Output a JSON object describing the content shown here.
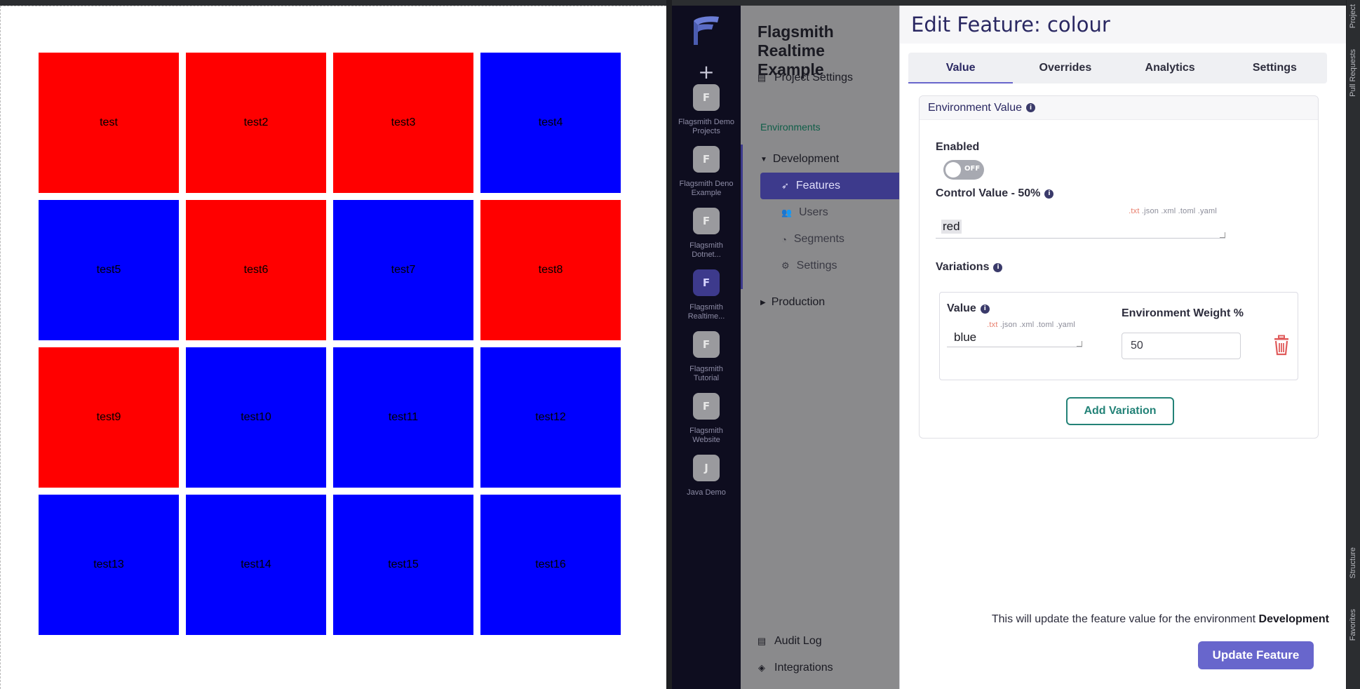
{
  "grid": {
    "cells": [
      {
        "label": "test",
        "color": "red"
      },
      {
        "label": "test2",
        "color": "red"
      },
      {
        "label": "test3",
        "color": "red"
      },
      {
        "label": "test4",
        "color": "blue"
      },
      {
        "label": "test5",
        "color": "blue"
      },
      {
        "label": "test6",
        "color": "red"
      },
      {
        "label": "test7",
        "color": "blue"
      },
      {
        "label": "test8",
        "color": "red"
      },
      {
        "label": "test9",
        "color": "red"
      },
      {
        "label": "test10",
        "color": "blue"
      },
      {
        "label": "test11",
        "color": "blue"
      },
      {
        "label": "test12",
        "color": "blue"
      },
      {
        "label": "test13",
        "color": "blue"
      },
      {
        "label": "test14",
        "color": "blue"
      },
      {
        "label": "test15",
        "color": "blue"
      },
      {
        "label": "test16",
        "color": "blue"
      }
    ]
  },
  "projects": {
    "add_label": "+",
    "items": [
      {
        "initial": "F",
        "name": "Flagsmith Demo Projects",
        "active": false
      },
      {
        "initial": "F",
        "name": "Flagsmith Deno Example",
        "active": false
      },
      {
        "initial": "F",
        "name": "Flagsmith Dotnet...",
        "active": false
      },
      {
        "initial": "F",
        "name": "Flagsmith Realtime...",
        "active": true
      },
      {
        "initial": "F",
        "name": "Flagsmith Tutorial",
        "active": false
      },
      {
        "initial": "F",
        "name": "Flagsmith Website",
        "active": false
      },
      {
        "initial": "J",
        "name": "Java Demo",
        "active": false
      }
    ]
  },
  "nav": {
    "project_title": "Flagsmith Realtime Example",
    "project_settings": "Project Settings",
    "environments_label": "Environments",
    "development": "Development",
    "features": "Features",
    "users": "Users",
    "segments": "Segments",
    "settings": "Settings",
    "production": "Production",
    "audit_log": "Audit Log",
    "integrations": "Integrations"
  },
  "modal": {
    "title": "Edit Feature: colour",
    "tabs": [
      "Value",
      "Overrides",
      "Analytics",
      "Settings"
    ],
    "active_tab": "Value",
    "env_value_heading": "Environment Value",
    "enabled_label": "Enabled",
    "toggle_text": "OFF",
    "control_label": "Control Value - 50%",
    "formats": [
      ".txt",
      ".json",
      ".xml",
      ".toml",
      ".yaml"
    ],
    "control_value": "red",
    "variations_label": "Variations",
    "variation_value_label": "Value",
    "variation_weight_label": "Environment Weight %",
    "variation_value": "blue",
    "variation_weight": "50",
    "add_variation": "Add Variation",
    "update_note_prefix": "This will update the feature value for the environment ",
    "update_note_env": "Development",
    "update_button": "Update Feature"
  },
  "ide": {
    "project_tab": "Project",
    "pull_requests": "Pull Requests",
    "structure": "Structure",
    "favorites": "Favorites"
  },
  "colors": {
    "red": "#ff0000",
    "blue": "#0000ff",
    "brand": "#6866cc",
    "accent_green": "#238277"
  }
}
